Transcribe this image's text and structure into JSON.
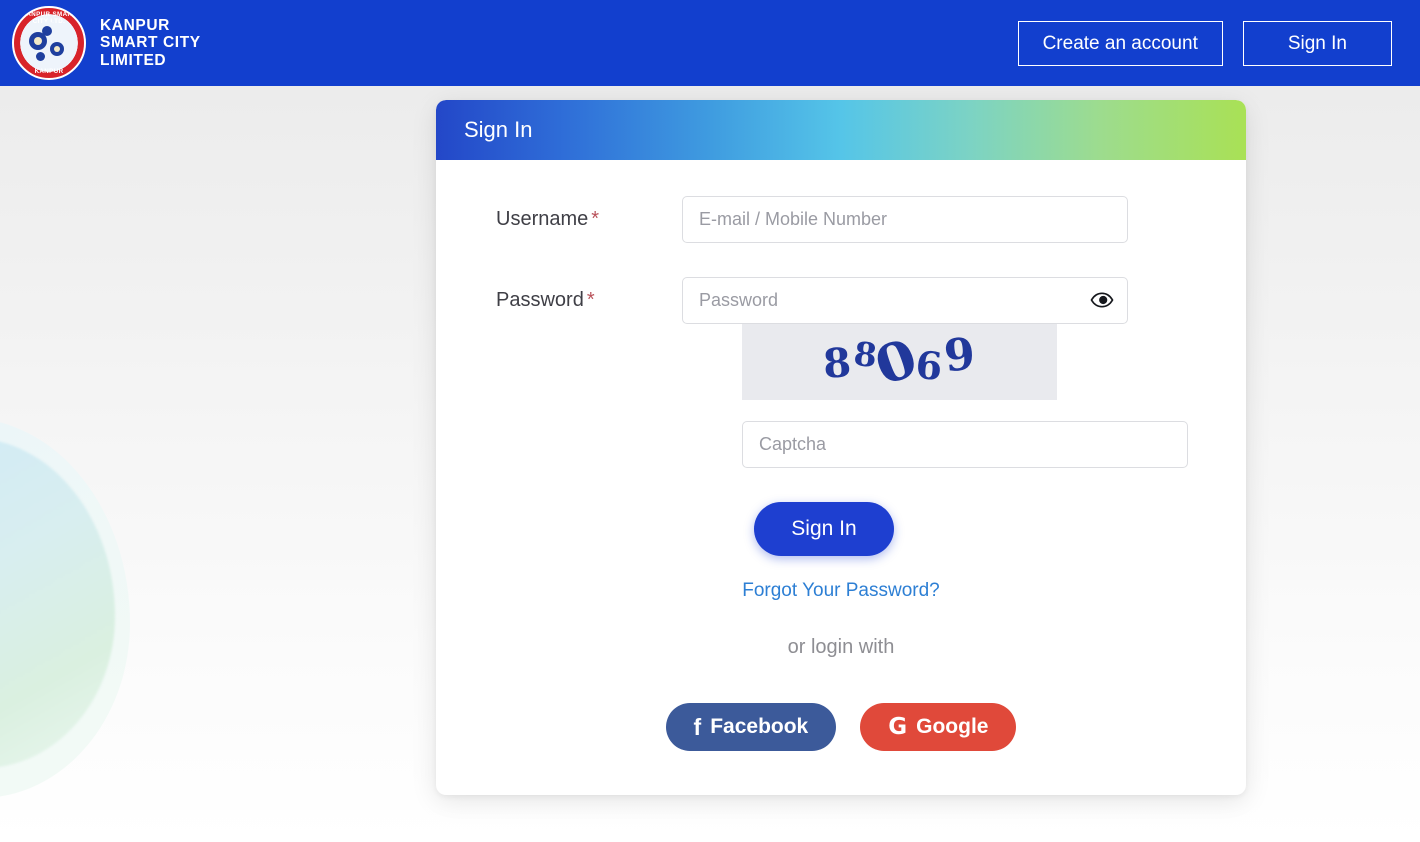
{
  "navbar": {
    "brand": {
      "name_line1": "KANPUR",
      "name_line2": "SMART CITY",
      "name_line3": "LIMITED",
      "logo_top_text": "KANPUR SMART CITY LTD.",
      "logo_bottom_text": "KANPUR",
      "logo_icon": "kanpur-smart-city-logo"
    },
    "create_account_label": "Create an account",
    "sign_in_label": "Sign In",
    "background_color": "#123FCE"
  },
  "card": {
    "header_title": "Sign In",
    "header_gradient_start": "#2347c8",
    "header_gradient_mid": "#55c5e8",
    "header_gradient_end": "#a9e155"
  },
  "form": {
    "username": {
      "label": "Username",
      "required_marker": "*",
      "placeholder": "E-mail / Mobile Number",
      "value": ""
    },
    "password": {
      "label": "Password",
      "required_marker": "*",
      "placeholder": "Password",
      "value": "",
      "toggle_icon": "eye-icon"
    },
    "captcha": {
      "text": "88069",
      "digits": [
        "8",
        "8",
        "0",
        "6",
        "9"
      ],
      "placeholder": "Captcha",
      "value": "",
      "image_background": "#e9eaee",
      "digit_color": "#21389b"
    },
    "submit_label": "Sign In",
    "submit_color": "#1e3fd0",
    "forgot_password_label": "Forgot Your Password?",
    "forgot_password_color": "#2d7fd4"
  },
  "social": {
    "divider_label": "or login with",
    "buttons": [
      {
        "label": "Facebook",
        "glyph": "f",
        "icon": "facebook-icon",
        "color": "#3c5a9a"
      },
      {
        "label": "Google",
        "glyph": "G",
        "icon": "google-icon",
        "color": "#e0493a"
      }
    ]
  }
}
